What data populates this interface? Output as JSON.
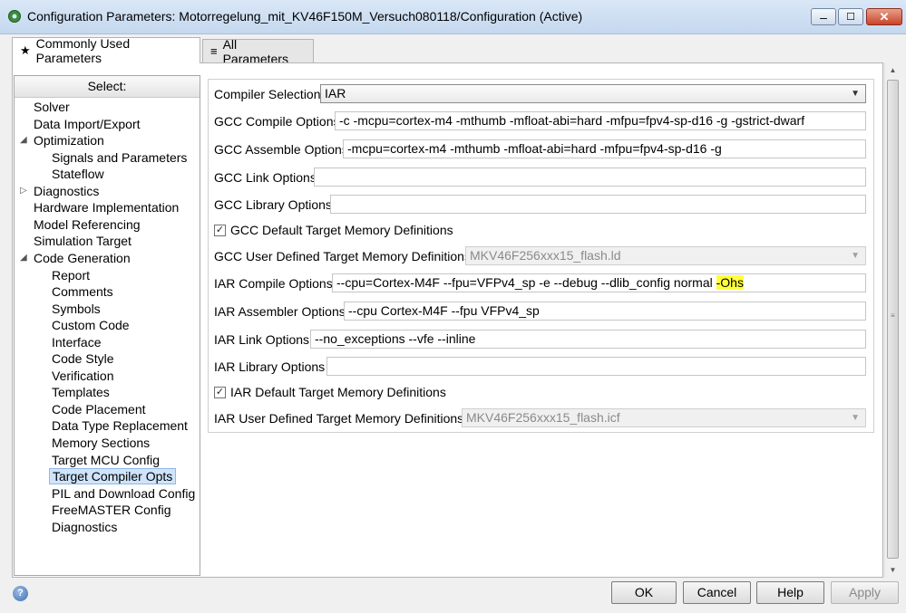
{
  "window": {
    "title": "Configuration Parameters: Motorregelung_mit_KV46F150M_Versuch080118/Configuration (Active)",
    "minimize_label": "‒",
    "maximize_label": "☐",
    "close_label": "✕"
  },
  "tabs": [
    {
      "label": "Commonly Used Parameters",
      "icon": "star-icon",
      "glyph": "★"
    },
    {
      "label": "All Parameters",
      "icon": "list-icon",
      "glyph": "≡"
    }
  ],
  "tree": {
    "header": "Select:",
    "items": [
      {
        "label": "Solver"
      },
      {
        "label": "Data Import/Export"
      },
      {
        "label": "Optimization",
        "expander": "◢"
      },
      {
        "label": "Signals and Parameters"
      },
      {
        "label": "Stateflow"
      },
      {
        "label": "Diagnostics",
        "expander": "▷"
      },
      {
        "label": "Hardware Implementation"
      },
      {
        "label": "Model Referencing"
      },
      {
        "label": "Simulation Target"
      },
      {
        "label": "Code Generation",
        "expander": "◢"
      },
      {
        "label": "Report"
      },
      {
        "label": "Comments"
      },
      {
        "label": "Symbols"
      },
      {
        "label": "Custom Code"
      },
      {
        "label": "Interface"
      },
      {
        "label": "Code Style"
      },
      {
        "label": "Verification"
      },
      {
        "label": "Templates"
      },
      {
        "label": "Code Placement"
      },
      {
        "label": "Data Type Replacement"
      },
      {
        "label": "Memory Sections"
      },
      {
        "label": "Target MCU Config"
      },
      {
        "label": "Target Compiler Opts",
        "selected": true
      },
      {
        "label": "PIL and Download Config"
      },
      {
        "label": "FreeMASTER Config"
      },
      {
        "label": "Diagnostics"
      }
    ]
  },
  "form": {
    "compiler_selection": {
      "label": "Compiler Selection",
      "value": "IAR"
    },
    "gcc_compile": {
      "label": "GCC Compile Options",
      "value": "-c -mcpu=cortex-m4 -mthumb -mfloat-abi=hard -mfpu=fpv4-sp-d16 -g -gstrict-dwarf"
    },
    "gcc_assemble": {
      "label": "GCC Assemble Options",
      "value": "-mcpu=cortex-m4 -mthumb -mfloat-abi=hard -mfpu=fpv4-sp-d16 -g"
    },
    "gcc_link": {
      "label": "GCC Link Options",
      "value": ""
    },
    "gcc_library": {
      "label": "GCC Library Options",
      "value": ""
    },
    "gcc_default_mem": {
      "label": "GCC Default Target Memory Definitions",
      "checked": true
    },
    "gcc_user_mem": {
      "label": "GCC User Defined Target Memory Definitions",
      "value": "MKV46F256xxx15_flash.ld"
    },
    "iar_compile": {
      "label": "IAR Compile Options",
      "value": "--cpu=Cortex-M4F --fpu=VFPv4_sp -e --debug --dlib_config normal ",
      "highlight": "-Ohs"
    },
    "iar_assembler": {
      "label": "IAR Assembler Options",
      "value": "--cpu Cortex-M4F --fpu VFPv4_sp"
    },
    "iar_link": {
      "label": "IAR Link Options",
      "value": "--no_exceptions --vfe --inline"
    },
    "iar_library": {
      "label": "IAR Library Options",
      "value": ""
    },
    "iar_default_mem": {
      "label": "IAR Default Target Memory Definitions",
      "checked": true
    },
    "iar_user_mem": {
      "label": "IAR User Defined Target Memory Definitions",
      "value": "MKV46F256xxx15_flash.icf"
    }
  },
  "buttons": {
    "ok": "OK",
    "cancel": "Cancel",
    "help": "Help",
    "apply": "Apply"
  },
  "help_icon_glyph": "?",
  "dropdown_glyph": "▼",
  "checkmark_glyph": "✓",
  "scroll": {
    "up_glyph": "▲",
    "down_glyph": "▼",
    "grip_glyph": "≡"
  }
}
